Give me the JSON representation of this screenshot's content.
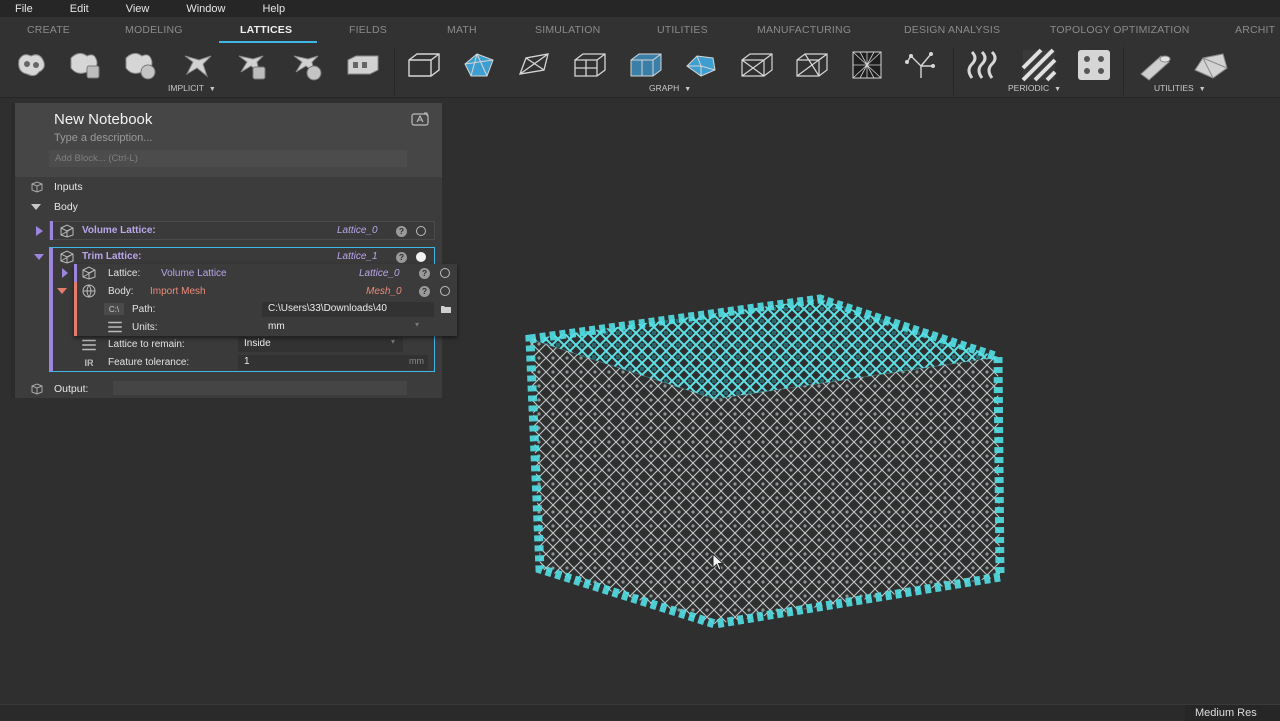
{
  "menubar": {
    "items": [
      "File",
      "Edit",
      "View",
      "Window",
      "Help"
    ]
  },
  "tabs": [
    {
      "label": "CREATE"
    },
    {
      "label": "MODELING"
    },
    {
      "label": "LATTICES"
    },
    {
      "label": "FIELDS"
    },
    {
      "label": "MATH"
    },
    {
      "label": "SIMULATION"
    },
    {
      "label": "UTILITIES"
    },
    {
      "label": "MANUFACTURING"
    },
    {
      "label": "DESIGN ANALYSIS"
    },
    {
      "label": "TOPOLOGY OPTIMIZATION"
    },
    {
      "label": "ARCHIT"
    }
  ],
  "active_tab": "LATTICES",
  "ribbon": {
    "groups": [
      {
        "label": "IMPLICIT",
        "icons": [
          "implicit-lattice-1-icon",
          "implicit-lattice-2-icon",
          "implicit-lattice-3-icon",
          "implicit-lattice-4-icon",
          "implicit-lattice-5-icon",
          "implicit-lattice-6-icon",
          "implicit-lattice-block-icon"
        ]
      },
      {
        "label": "GRAPH",
        "icons": [
          "graph-box-icon",
          "graph-surface-icon",
          "graph-tilted-icon",
          "graph-box-2-icon",
          "graph-box-3-icon",
          "graph-surface-2-icon",
          "graph-box-4-icon",
          "graph-diagonal-icon",
          "graph-dense-icon",
          "graph-tree-icon"
        ]
      },
      {
        "label": "PERIODIC",
        "icons": [
          "periodic-wave-icon",
          "periodic-stripes-icon",
          "periodic-dots-icon"
        ]
      },
      {
        "label": "UTILITIES",
        "icons": [
          "utility-cylinder-icon",
          "utility-shape-icon"
        ]
      }
    ]
  },
  "notebook": {
    "title": "New Notebook",
    "description_placeholder": "Type a description...",
    "add_block_placeholder": "Add Block... (Ctrl-L)",
    "inputs_label": "Inputs",
    "body_label": "Body",
    "output_label": "Output:",
    "blocks": [
      {
        "title": "Volume Lattice:",
        "variable": "Lattice_0"
      },
      {
        "title": "Trim Lattice:",
        "variable": "Lattice_1",
        "rows": {
          "lattice": {
            "key": "Lattice:",
            "value": "Volume Lattice",
            "variable": "Lattice_0"
          },
          "body": {
            "key": "Body:",
            "value": "Import Mesh",
            "variable": "Mesh_0"
          },
          "path": {
            "key": "Path:",
            "prefix": "C:\\",
            "value": "C:\\Users\\33\\Downloads\\40"
          },
          "units": {
            "key": "Units:",
            "value": "mm"
          },
          "remain": {
            "key": "Lattice to remain:",
            "value": "Inside"
          },
          "tolerance": {
            "key": "Feature tolerance:",
            "value": "1",
            "unit": "mm"
          }
        }
      }
    ]
  },
  "status": {
    "resolution": "Medium Res"
  },
  "colors": {
    "accent": "#3fb6e8",
    "lattice_edges": "#52e0e6",
    "purple": "#9d85dd",
    "salmon": "#e47c6b"
  }
}
